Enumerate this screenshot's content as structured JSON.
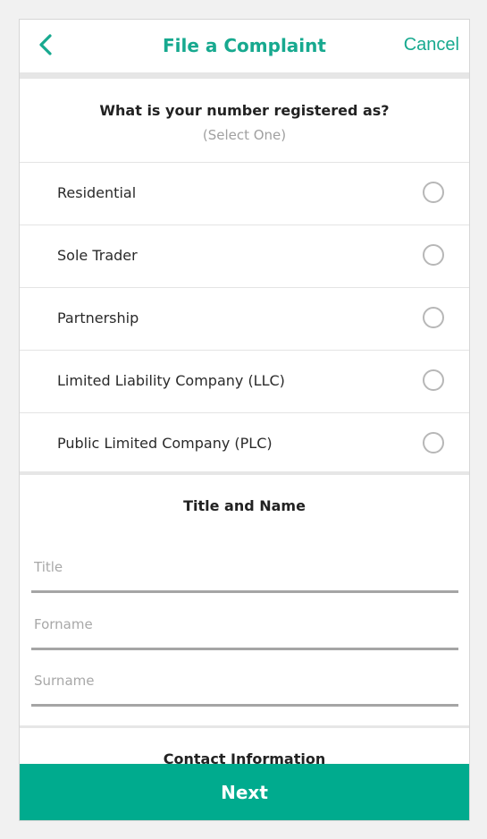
{
  "header": {
    "title": "File a Complaint",
    "cancel_label": "Cancel",
    "back_icon": "chevron-left-icon"
  },
  "question": {
    "title": "What is your number registered as?",
    "hint": "(Select One)"
  },
  "options": [
    {
      "label": "Residential",
      "selected": false
    },
    {
      "label": "Sole Trader",
      "selected": false
    },
    {
      "label": "Partnership",
      "selected": false
    },
    {
      "label": "Limited Liability Company (LLC)",
      "selected": false
    },
    {
      "label": "Public Limited Company (PLC)",
      "selected": false
    }
  ],
  "name_section": {
    "title": "Title and Name",
    "fields": [
      {
        "placeholder": "Title",
        "value": ""
      },
      {
        "placeholder": "Forname",
        "value": ""
      },
      {
        "placeholder": "Surname",
        "value": ""
      }
    ]
  },
  "contact_section": {
    "title": "Contact Information"
  },
  "footer": {
    "next_label": "Next"
  },
  "colors": {
    "accent": "#17a98f",
    "button": "#00ab8e",
    "divider": "#e6e6e6"
  }
}
